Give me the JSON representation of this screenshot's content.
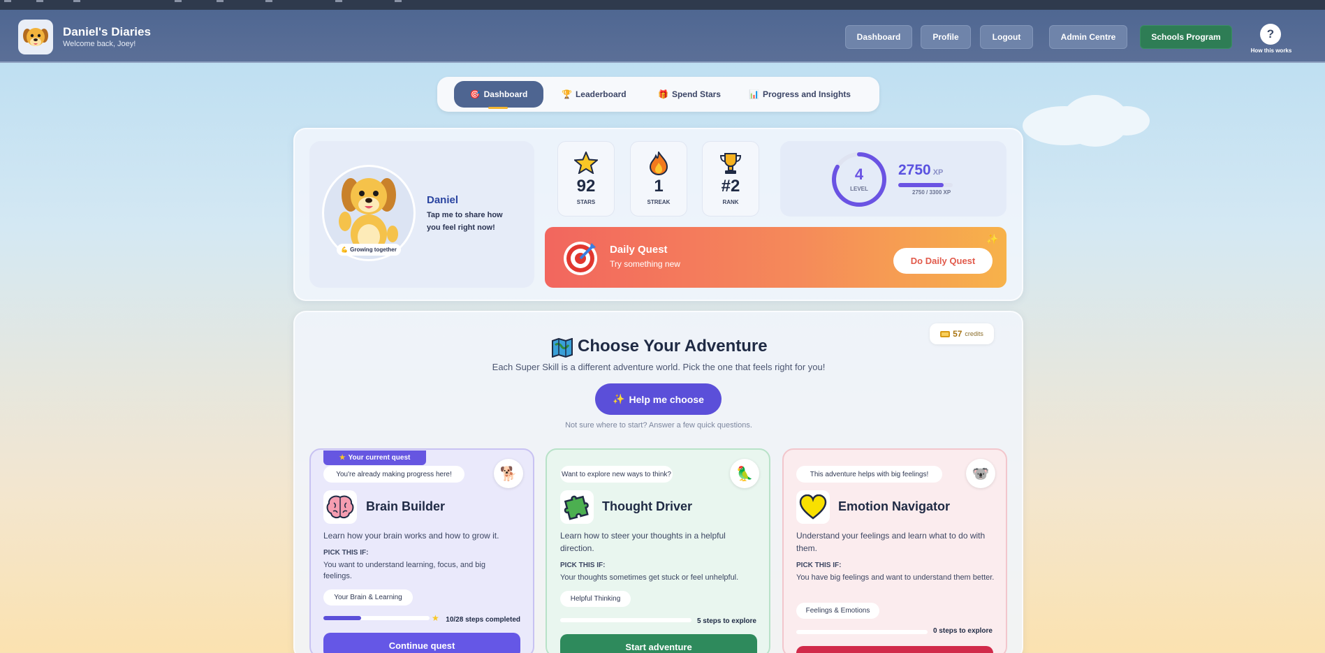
{
  "header": {
    "title": "Daniel's Diaries",
    "subtitle": "Welcome back, Joey!",
    "nav": [
      "Dashboard",
      "Profile",
      "Logout",
      "Admin Centre",
      "Schools Program"
    ],
    "help_label": "How this works",
    "help_glyph": "?"
  },
  "tabs": [
    {
      "label": "Dashboard",
      "icon": "target-icon"
    },
    {
      "label": "Leaderboard",
      "icon": "trophy-icon"
    },
    {
      "label": "Spend Stars",
      "icon": "gift-icon"
    },
    {
      "label": "Progress and Insights",
      "icon": "bar-chart-icon"
    }
  ],
  "profile": {
    "name": "Daniel",
    "prompt": "Tap me to share how you feel right now!",
    "badge": "Growing together"
  },
  "stats": [
    {
      "value": "92",
      "label": "STARS",
      "icon": "star-icon"
    },
    {
      "value": "1",
      "label": "STREAK",
      "icon": "flame-icon"
    },
    {
      "value": "#2",
      "label": "RANK",
      "icon": "trophy-icon"
    }
  ],
  "level": {
    "value": "4",
    "label": "LEVEL",
    "xp": "2750",
    "xp_unit": "XP",
    "xp_progress": "2750 / 3300 XP",
    "progress_fraction": 0.833
  },
  "daily_quest": {
    "title": "Daily Quest",
    "subtitle": "Try something new",
    "button": "Do Daily Quest"
  },
  "credits": {
    "value": "57",
    "label": "credits"
  },
  "adventure": {
    "title": "Choose Your Adventure",
    "subtitle": "Each Super Skill is a different adventure world. Pick the one that feels right for you!",
    "help_button": "Help me choose",
    "hint": "Not sure where to start? Answer a few quick questions."
  },
  "cards": [
    {
      "current_tag": "Your current quest",
      "bubble": "You're already making progress here!",
      "title": "Brain Builder",
      "description": "Learn how your brain works and how to grow it.",
      "pick_label": "PICK THIS IF:",
      "pick_text": "You want to understand learning, focus, and big feelings.",
      "tag": "Your Brain & Learning",
      "steps": "10/28 steps completed",
      "progress_fraction": 0.357,
      "button": "Continue quest",
      "color": "#6656e1"
    },
    {
      "bubble": "Want to explore new ways to think?",
      "title": "Thought Driver",
      "description": "Learn how to steer your thoughts in a helpful direction.",
      "pick_label": "PICK THIS IF:",
      "pick_text": "Your thoughts sometimes get stuck or feel unhelpful.",
      "tag": "Helpful Thinking",
      "steps": "5 steps to explore",
      "progress_fraction": 0,
      "button": "Start adventure",
      "color": "#2e8a5c"
    },
    {
      "bubble": "This adventure helps with big feelings!",
      "title": "Emotion Navigator",
      "description": "Understand your feelings and learn what to do with them.",
      "pick_label": "PICK THIS IF:",
      "pick_text": "You have big feelings and want to understand them better.",
      "tag": "Feelings & Emotions",
      "steps": "0 steps to explore",
      "progress_fraction": 0,
      "color": "#d12a4a"
    }
  ]
}
